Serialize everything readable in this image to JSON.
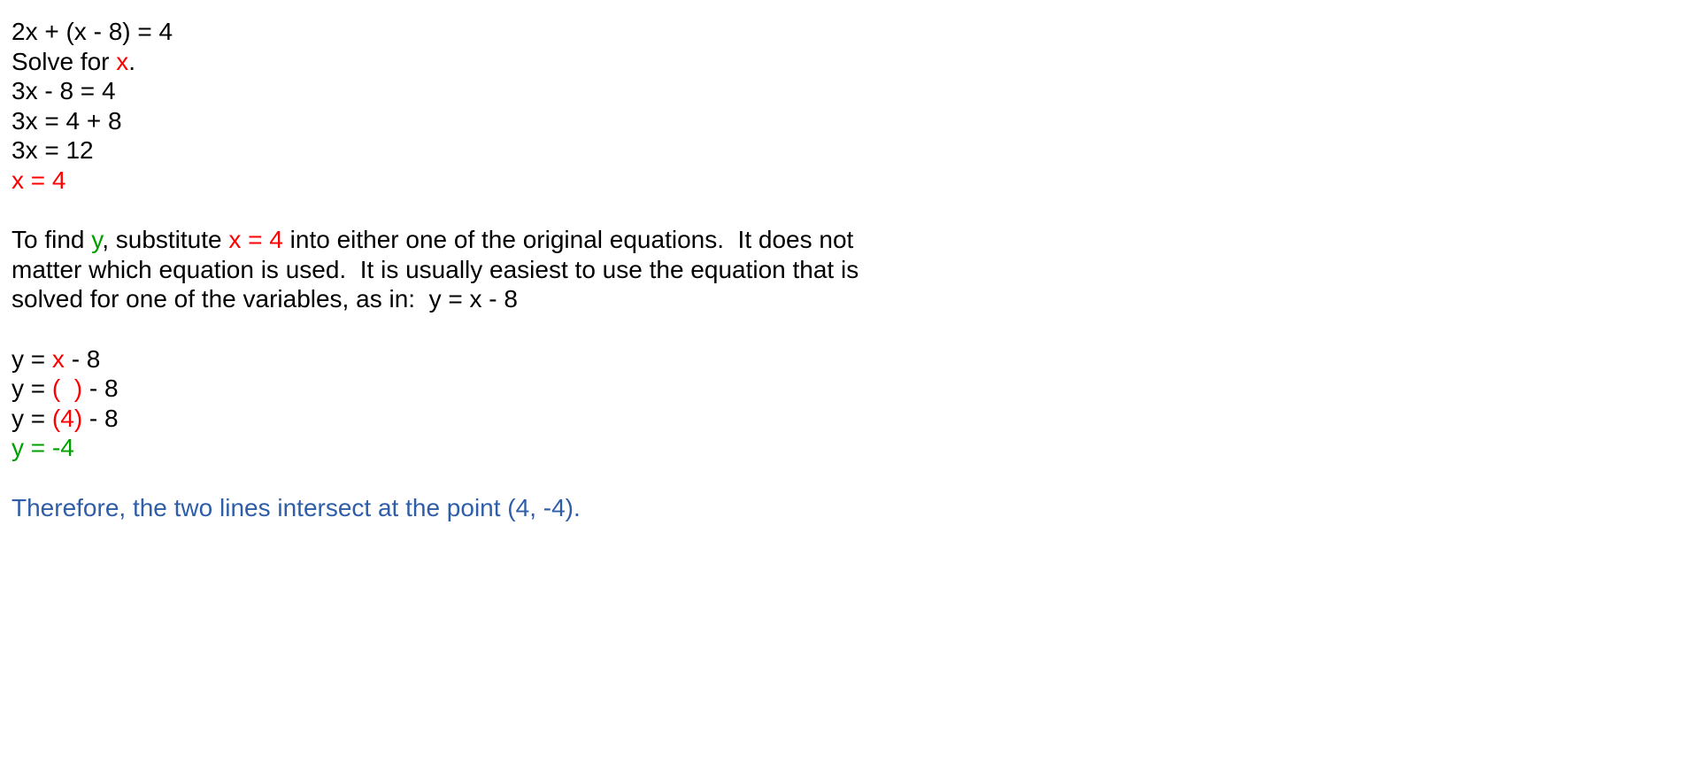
{
  "colors": {
    "text": "#000000",
    "x_highlight": "#ff0000",
    "y_highlight": "#00a000",
    "conclusion": "#2e5ea8"
  },
  "solve_x": {
    "equation": "2x + (x - 8) = 4",
    "instruction_prefix": "Solve for ",
    "instruction_var": "x",
    "instruction_suffix": ".",
    "step1": "3x - 8 = 4",
    "step2": "3x = 4 + 8",
    "step3": "3x = 12",
    "result": "x = 4"
  },
  "explanation": {
    "line1_prefix": "To find ",
    "line1_y": "y",
    "line1_mid": ", substitute ",
    "line1_x": "x = 4",
    "line1_suffix": " into either one of the original equations.  It does not",
    "line2": "matter which equation is used.  It is usually easiest to use the equation that is",
    "line3": "solved for one of the variables, as in:  y = x - 8"
  },
  "solve_y": {
    "line1_prefix": "y = ",
    "line1_x": "x",
    "line1_suffix": " - 8",
    "line2_prefix": "y = ",
    "line2_paren": "(  )",
    "line2_suffix": " - 8",
    "line3_prefix": "y = ",
    "line3_paren": "(4)",
    "line3_suffix": " - 8",
    "result": "y = -4"
  },
  "conclusion": "Therefore, the two lines intersect at the point (4, -4)."
}
